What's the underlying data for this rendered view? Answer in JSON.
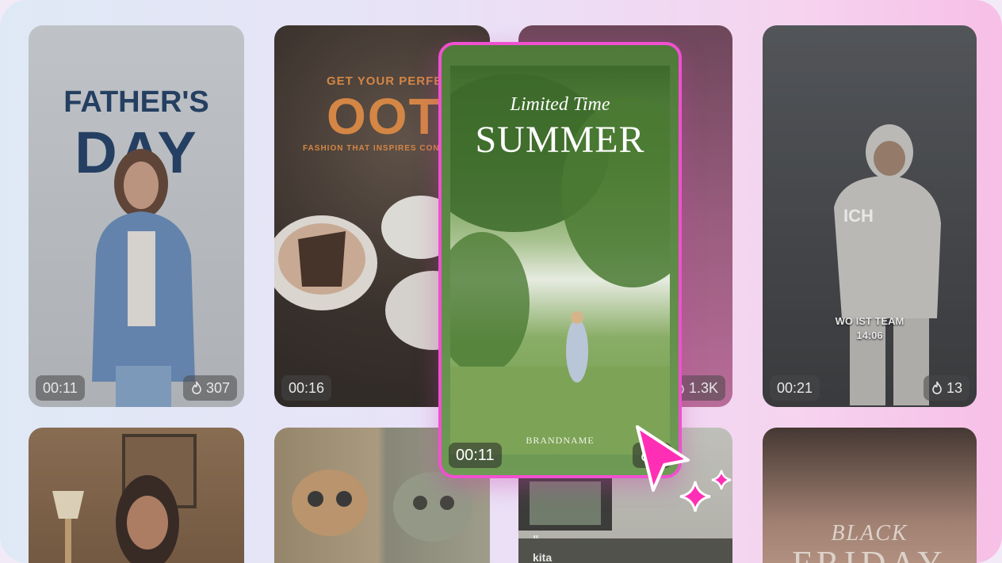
{
  "cards": [
    {
      "title_line1": "FATHER'S",
      "title_line2": "DAY",
      "duration": "00:11",
      "likes": "307"
    },
    {
      "kicker": "GET YOUR PERFECT",
      "title": "OOTD",
      "subtitle": "FASHION THAT INSPIRES CONFI",
      "duration": "00:16"
    },
    {
      "likes": "1.3K"
    },
    {
      "sign": "ICH",
      "caption_line1": "WO IST TEAM",
      "caption_line2": "14:06",
      "duration": "00:21",
      "likes": "13"
    },
    {},
    {},
    {
      "caption_top": "\"",
      "caption_text": "kita"
    },
    {
      "script_word": "BLACK",
      "big_word": "FRIDAY"
    }
  ],
  "featured": {
    "script": "Limited Time",
    "title": "SUMMER",
    "brand": "BRANDNAME",
    "duration": "00:11",
    "likes": "1"
  },
  "colors": {
    "accent": "#f050d0",
    "cursor": "#ff2fb5"
  },
  "icons": {
    "likes": "flame-icon",
    "pointer": "cursor-icon",
    "sparkle": "sparkle-icon"
  }
}
